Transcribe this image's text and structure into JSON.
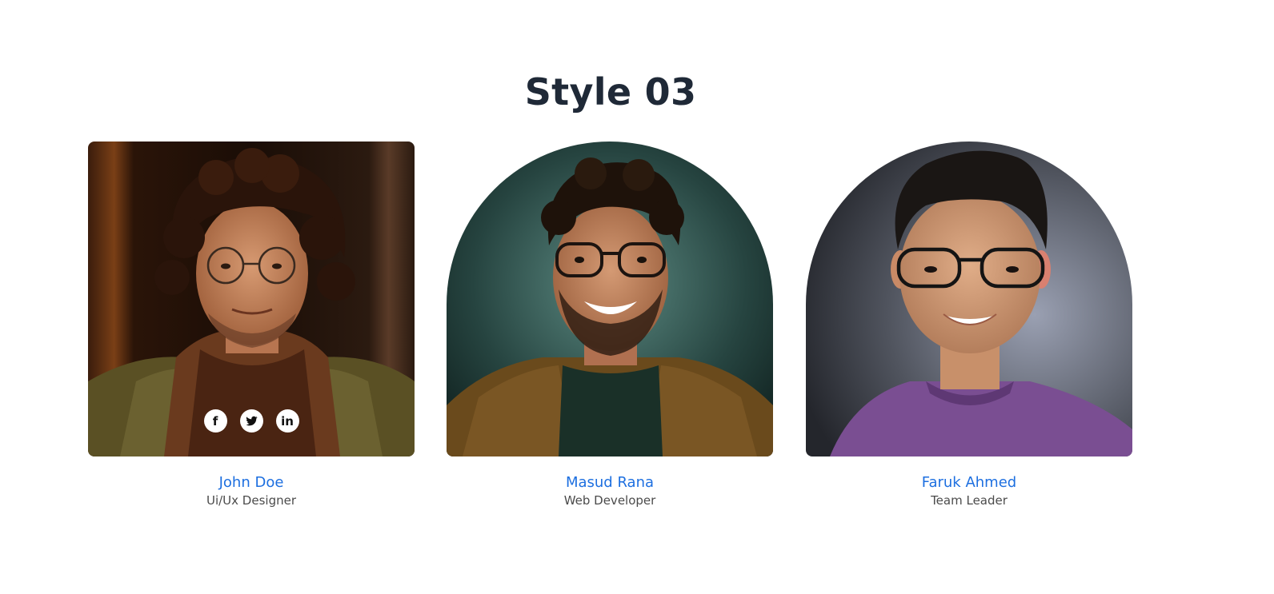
{
  "section": {
    "title": "Style 03"
  },
  "members": [
    {
      "name": "John Doe",
      "role": "Ui/Ux Designer",
      "socials": [
        {
          "icon": "facebook-icon",
          "glyph": "f"
        },
        {
          "icon": "twitter-icon",
          "glyph": ""
        },
        {
          "icon": "linkedin-icon",
          "glyph": "in"
        }
      ]
    },
    {
      "name": "Masud Rana",
      "role": "Web Developer"
    },
    {
      "name": "Faruk Ahmed",
      "role": "Team Leader"
    }
  ],
  "colors": {
    "title": "#1f2937",
    "name_link": "#1d6fe0",
    "role_text": "#4b4b4b"
  }
}
